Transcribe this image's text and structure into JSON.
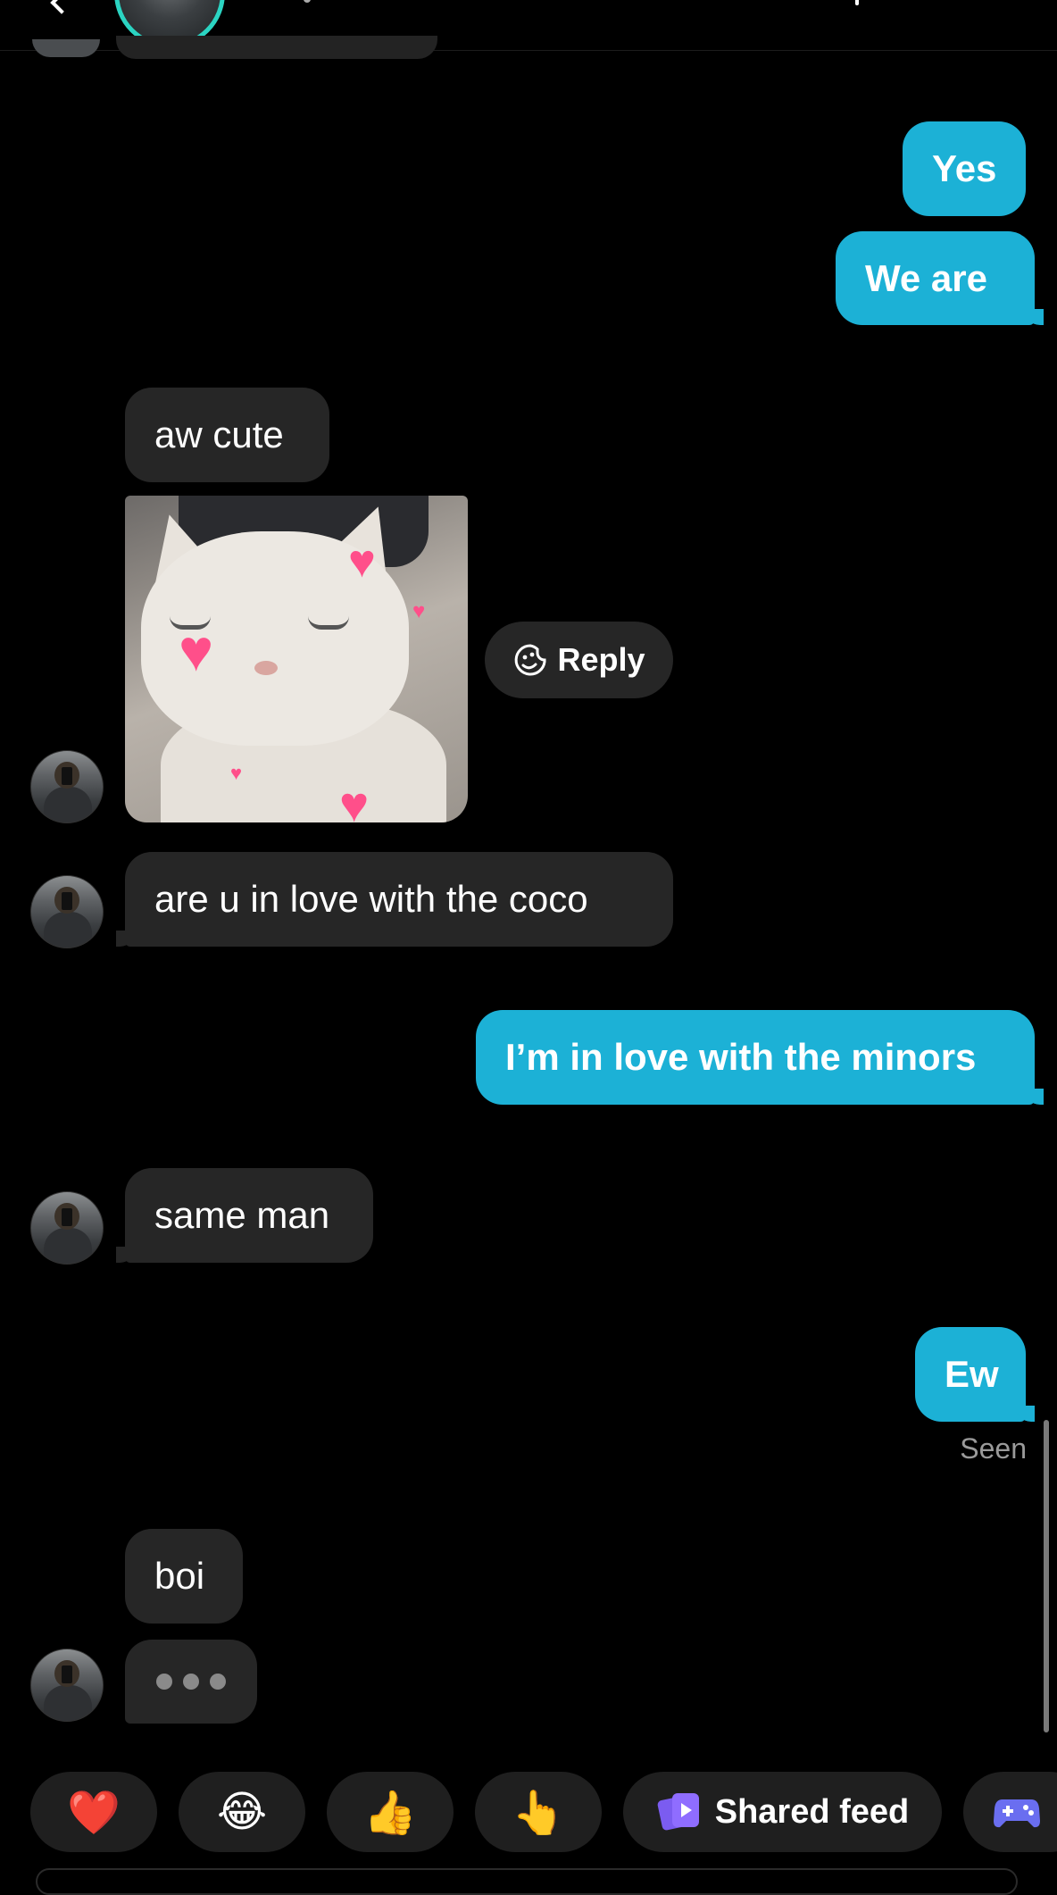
{
  "header": {
    "avatar_icon": "contact-avatar-icon"
  },
  "messages": {
    "m1": "Yes",
    "m2": "We are",
    "m3": "aw cute",
    "m4": "are u in love with the coco",
    "m5": "I’m in love with the minors",
    "m6": "same man",
    "m7": "Ew",
    "m8": "boi"
  },
  "gif": {
    "icon": "cat-hearts-sticker",
    "heart_color": "#ff4f8a"
  },
  "reply": {
    "label": "Reply",
    "icon": "sticker-smile-icon"
  },
  "status": {
    "seen": "Seen"
  },
  "typing": {
    "icon": "typing-indicator"
  },
  "quick_bar": {
    "items": [
      {
        "emoji": "❤️",
        "icon": "heart-emoji"
      },
      {
        "emoji": "😂",
        "icon": "laughing-emoji"
      },
      {
        "emoji": "👍",
        "icon": "thumbs-up-emoji"
      },
      {
        "emoji": "👆",
        "icon": "pointing-finger-emoji"
      },
      {
        "label": "Shared feed",
        "icon": "shared-feed-icon"
      },
      {
        "icon": "game-controller-icon"
      }
    ]
  },
  "colors": {
    "outgoing": "#1cb1d6",
    "incoming": "#262626",
    "background": "#000000"
  }
}
